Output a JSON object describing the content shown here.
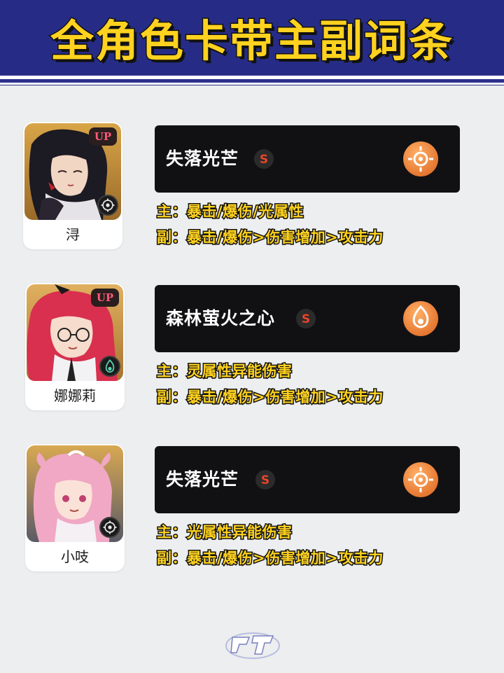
{
  "header": {
    "title": "全角色卡带主副词条"
  },
  "entries": [
    {
      "character": {
        "name": "浔",
        "badge": "UP",
        "element_icon": "light-element-icon"
      },
      "item": {
        "name": "失落光芒",
        "icon": "light-orb-icon"
      },
      "main_stat": "主：暴击/爆伤/光属性",
      "sub_stat": "副：暴击/爆伤>伤害增加>攻击力"
    },
    {
      "character": {
        "name": "娜娜莉",
        "badge": "UP",
        "element_icon": "spirit-element-icon"
      },
      "item": {
        "name": "森林萤火之心",
        "icon": "spirit-orb-icon"
      },
      "main_stat": "主：灵属性异能伤害",
      "sub_stat": "副：暴击/爆伤>伤害增加>攻击力"
    },
    {
      "character": {
        "name": "小吱",
        "badge": "",
        "element_icon": "light-element-icon"
      },
      "item": {
        "name": "失落光芒",
        "icon": "light-orb-icon"
      },
      "main_stat": "主：光属性异能伤害",
      "sub_stat": "副：暴击/爆伤>伤害增加>攻击力"
    }
  ],
  "footer": {
    "logo": "game-logo"
  },
  "colors": {
    "header_bg": "#262c86",
    "title_yellow": "#ffd21f",
    "item_bar": "#111113",
    "orb_orange": "#f08a3a",
    "badge_pink": "#ff5a78"
  }
}
